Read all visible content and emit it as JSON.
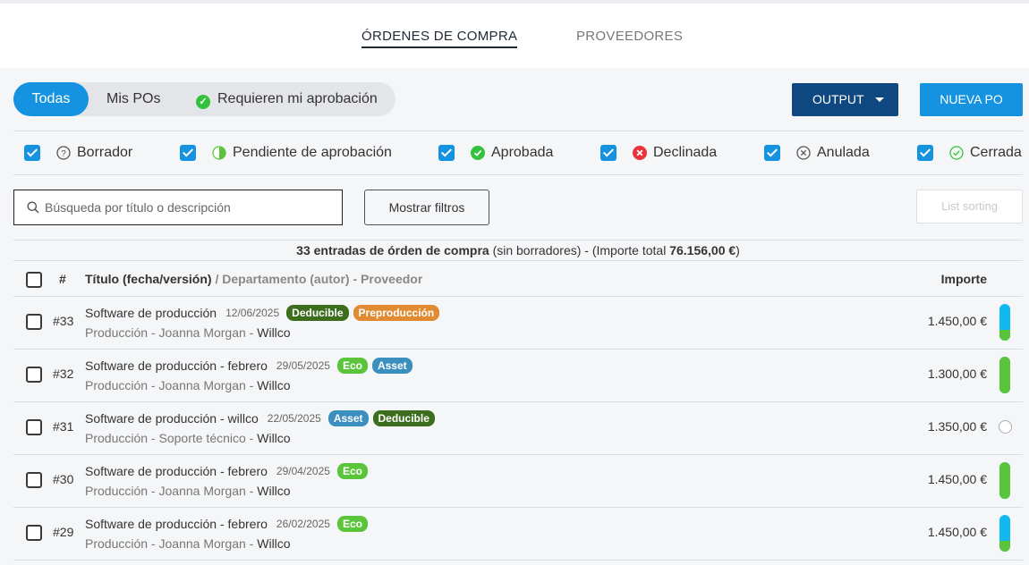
{
  "tabs": [
    {
      "label": "ÓRDENES DE COMPRA",
      "active": true
    },
    {
      "label": "PROVEEDORES",
      "active": false
    }
  ],
  "segment": {
    "todas": "Todas",
    "mis": "Mis POs",
    "requieren": "Requieren mi aprobación",
    "selected": "Todas"
  },
  "buttons": {
    "output": "OUTPUT",
    "nueva": "NUEVA PO",
    "filtros": "Mostrar filtros",
    "sorting": "List sorting"
  },
  "statuses": [
    {
      "label": "Borrador",
      "checked": true,
      "icon": "question-circle-icon"
    },
    {
      "label": "Pendiente de aprobación",
      "checked": true,
      "icon": "half-circle-icon"
    },
    {
      "label": "Aprobada",
      "checked": true,
      "icon": "check-circle-green-icon"
    },
    {
      "label": "Declinada",
      "checked": true,
      "icon": "x-circle-red-icon"
    },
    {
      "label": "Anulada",
      "checked": true,
      "icon": "x-circle-outline-icon"
    },
    {
      "label": "Cerrada",
      "checked": true,
      "icon": "check-circle-outline-icon"
    }
  ],
  "search": {
    "placeholder": "Búsqueda por título o descripción",
    "value": ""
  },
  "summary": {
    "count": "33 entradas de órden de compra",
    "note": " (sin borradores)  -   (Importe total ",
    "total": "76.156,00 €",
    "close": ")"
  },
  "table_header": {
    "hash": "#",
    "title": "Título (fecha/versión)",
    "sub": " / Departamento (autor) - Proveedor",
    "amount": "Importe"
  },
  "colors": {
    "primary": "#1693e0",
    "dark_blue": "#0f4780",
    "green": "#5ac53a",
    "cyan": "#12b8f0",
    "badge_deducible": "#3c6e1e",
    "badge_preproduccion": "#e08a32",
    "badge_eco": "#5ac53a",
    "badge_asset": "#3a8fbf"
  },
  "rows": [
    {
      "num": "#33",
      "title": "Software de producción",
      "date": "12/06/2025",
      "badges": [
        {
          "text": "Deducible",
          "color": "#3c6e1e"
        },
        {
          "text": "Preproducción",
          "color": "#e08a32"
        }
      ],
      "dept": "Producción",
      "author": "Joanna Morgan",
      "supplier": "Willco",
      "amount": "1.450,00 €",
      "progress": {
        "type": "bar",
        "green_fraction": 0.3,
        "rest_color": "#12b8f0"
      }
    },
    {
      "num": "#32",
      "title": "Software de producción - febrero",
      "date": "29/05/2025",
      "badges": [
        {
          "text": "Eco",
          "color": "#5ac53a"
        },
        {
          "text": "Asset",
          "color": "#3a8fbf"
        }
      ],
      "dept": "Producción",
      "author": "Joanna Morgan",
      "supplier": "Willco",
      "amount": "1.300,00 €",
      "progress": {
        "type": "bar",
        "green_fraction": 1.0,
        "rest_color": "#12b8f0"
      }
    },
    {
      "num": "#31",
      "title": "Software de producción - willco",
      "date": "22/05/2025",
      "badges": [
        {
          "text": "Asset",
          "color": "#3a8fbf"
        },
        {
          "text": "Deducible",
          "color": "#3c6e1e"
        }
      ],
      "dept": "Producción",
      "author": "Soporte técnico",
      "supplier": "Willco",
      "amount": "1.350,00 €",
      "progress": {
        "type": "ring"
      }
    },
    {
      "num": "#30",
      "title": "Software de producción - febrero",
      "date": "29/04/2025",
      "badges": [
        {
          "text": "Eco",
          "color": "#5ac53a"
        }
      ],
      "dept": "Producción",
      "author": "Joanna Morgan",
      "supplier": "Willco",
      "amount": "1.450,00 €",
      "progress": {
        "type": "bar",
        "green_fraction": 1.0,
        "rest_color": "#12b8f0"
      }
    },
    {
      "num": "#29",
      "title": "Software de producción - febrero",
      "date": "26/02/2025",
      "badges": [
        {
          "text": "Eco",
          "color": "#5ac53a"
        }
      ],
      "dept": "Producción",
      "author": "Joanna Morgan",
      "supplier": "Willco",
      "amount": "1.450,00 €",
      "progress": {
        "type": "bar",
        "green_fraction": 0.3,
        "rest_color": "#12b8f0"
      }
    }
  ]
}
